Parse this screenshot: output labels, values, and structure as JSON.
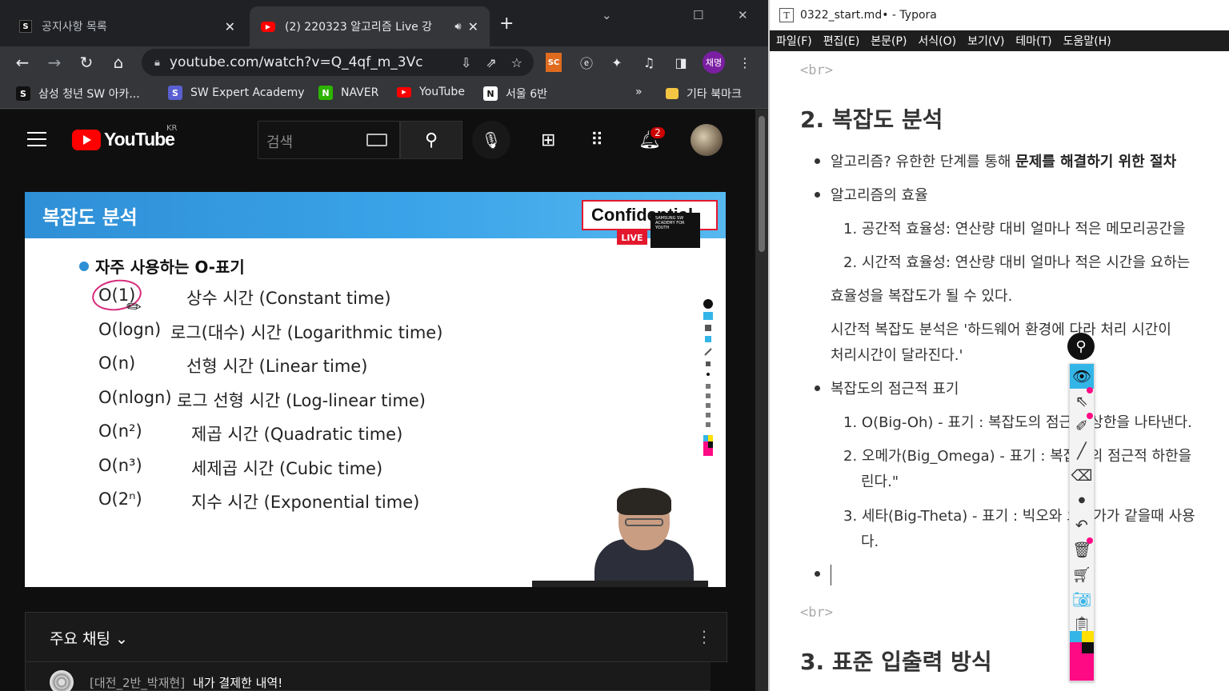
{
  "browser": {
    "tabs": [
      {
        "title": "공지사항 목록",
        "favicon": "swea-icon"
      },
      {
        "title": "(2) 220323 알고리즘 Live 강",
        "favicon": "youtube-icon"
      }
    ],
    "url": "youtube.com/watch?v=Q_4qf_m_3Vc",
    "profile_label": "채명",
    "ext_label": "SC",
    "bookmarks": [
      {
        "label": "삼성 청년 SW 아카..."
      },
      {
        "label": "SW Expert Academy"
      },
      {
        "label": "NAVER"
      },
      {
        "label": "YouTube"
      },
      {
        "label": "서울 6반"
      }
    ],
    "overflow": "»",
    "other_bookmarks": "기타 북마크"
  },
  "youtube": {
    "logo_text": "YouTube",
    "region": "KR",
    "search_placeholder": "검색",
    "notification_count": "2",
    "slide": {
      "title": "복잡도 분석",
      "confidential": "Confidential",
      "live": "LIVE",
      "academy": "SAMSUNG SW ACADEMY FOR YOUTH",
      "bullet": "자주 사용하는 O-표기",
      "rows": [
        {
          "o": "O(1)",
          "desc": "상수 시간 (Constant time)"
        },
        {
          "o": "O(logn)",
          "desc": "로그(대수) 시간 (Logarithmic time)"
        },
        {
          "o": "O(n)",
          "desc": "선형 시간 (Linear time)"
        },
        {
          "o": "O(nlogn)",
          "desc": "로그 선형 시간 (Log-linear time)"
        },
        {
          "o": "O(n²)",
          "desc": "제곱 시간 (Quadratic time)"
        },
        {
          "o": "O(n³)",
          "desc": "세제곱 시간 (Cubic time)"
        },
        {
          "o": "O(2ⁿ)",
          "desc": "지수 시간 (Exponential time)"
        }
      ]
    },
    "chat": {
      "title": "주요 채팅",
      "message": {
        "author": "[대전_2반_박재현]",
        "text": "내가 결제한 내역!"
      }
    }
  },
  "typora": {
    "title": "0322_start.md• - Typora",
    "menu": [
      "파일(F)",
      "편집(E)",
      "본문(P)",
      "서식(O)",
      "보기(V)",
      "테마(T)",
      "도움말(H)"
    ],
    "br": "<br>",
    "heading2": "2. 복잡도 분석",
    "items": {
      "algo_pre": "알고리즘? 유한한 단계를 통해 ",
      "algo_bold": "문제를 해결하기 위한 절차",
      "efficiency": "알고리즘의 효율",
      "ol1": "1. 공간적 효율성: 연산량 대비 얼마나 적은 메모리공간을",
      "ol2": "2. 시간적 효율성: 연산량 대비 얼마나 적은 시간을 요하는",
      "para1": "효율성을 복잡도가 될 수 있다.",
      "para2a": "시간적 복잡도 분석은 '하드웨어 환경에 다라 처리 시간이",
      "para2b": "처리시간이 달라진다.'",
      "asym": "복잡도의 점근적 표기",
      "bigoh": "1. O(Big-Oh) - 표기 : 복잡도의 점근적 상한을 나타낸다.",
      "omega": "2. 오메가(Big_Omega) - 표기 : 복잡도의 점근적 하한을",
      "omega_cont": "린다.\"",
      "theta": "3. 세타(Big-Theta) - 표기 : 빅오와 오메가가 같을때 사용",
      "theta_cont": "다."
    },
    "heading3": "3. 표준 입출력 방식"
  },
  "colors": {
    "youtube_red": "#ff0000",
    "slide_blue": "#2f8fd6",
    "confidential_red": "#e3182d",
    "pen_magenta": "#ff0a85",
    "pen_cyan": "#34b5e8"
  }
}
